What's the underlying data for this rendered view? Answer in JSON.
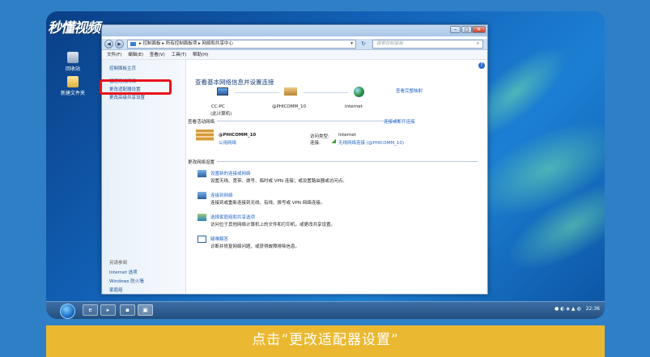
{
  "logo": "秒懂视频",
  "desktop": {
    "icons": [
      {
        "label": "回收站"
      },
      {
        "label": "新建文件夹"
      }
    ]
  },
  "window": {
    "address": "▸ 控制面板 ▸ 所有控制面板项 ▸ 网络和共享中心",
    "search_placeholder": "搜索控制面板",
    "menu": [
      "文件(F)",
      "编辑(E)",
      "查看(V)",
      "工具(T)",
      "帮助(H)"
    ],
    "sidebar": {
      "items": [
        "控制面板主页",
        "管理无线网络",
        "更改适配器设置",
        "更改高级共享设置"
      ],
      "see_also_title": "另请参阅",
      "see_also": [
        "Internet 选项",
        "Windows 防火墙",
        "家庭组"
      ]
    },
    "main": {
      "title": "查看基本网络信息并设置连接",
      "full_map": "查看完整映射",
      "nodes": [
        {
          "name": "CC-PC",
          "sub": "(此计算机)"
        },
        {
          "name": "@PHICOMM_10",
          "sub": ""
        },
        {
          "name": "Internet",
          "sub": ""
        }
      ],
      "active_header": "查看活动网络",
      "connect_link": "连接或断开连接",
      "network_name": "@PHICOMM_10",
      "network_type": "公用网络",
      "access_label": "访问类型:",
      "access_value": "Internet",
      "conn_label": "连接:",
      "conn_value": "无线网络连接 (@PHICOMM_10)",
      "change_header": "更改网络设置",
      "tasks": [
        {
          "title": "设置新的连接或网络",
          "desc": "设置无线、宽带、拨号、临时或 VPN 连接；或设置路由器或访问点。"
        },
        {
          "title": "连接到网络",
          "desc": "连接到或重新连接到无线、有线、拨号或 VPN 网络连接。"
        },
        {
          "title": "选择家庭组和共享选项",
          "desc": "访问位于其他网络计算机上的文件和打印机，或更改共享设置。"
        },
        {
          "title": "疑难解答",
          "desc": "诊断并修复网络问题，或获得故障排除信息。"
        }
      ]
    }
  },
  "taskbar": {
    "clock": "22:36"
  },
  "caption": "点击“更改适配器设置”",
  "colors": {
    "highlight": "#e8141b",
    "caption_bg": "#ebb931",
    "link": "#1e64c8"
  }
}
